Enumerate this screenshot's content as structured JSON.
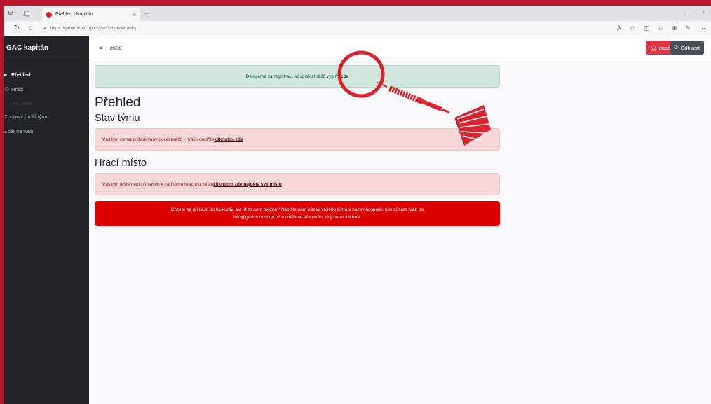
{
  "browser": {
    "tab_title": "Přehled | Kapitán",
    "tab_close": "×",
    "new_tab": "+",
    "url": "https://gambrinuscup.cz/tym?show=thanks",
    "minimize": "–",
    "restore": "▫"
  },
  "sidebar": {
    "brand": "GAC kapitán",
    "items": [
      {
        "label": "Přehled",
        "icon": "dashboard-icon"
      },
      {
        "label": "Hráči",
        "icon": "players-icon"
      }
    ],
    "heading": "ZÁKLADNÍ",
    "links": [
      {
        "label": "Zobrazit profil týmu"
      },
      {
        "label": "Zpět na web"
      }
    ]
  },
  "topbar": {
    "user_text": "csad",
    "user_button": "dasd",
    "logout_button": "Odhlásit"
  },
  "alerts": {
    "success_text": "Děkujeme za registraci, soupisku hráčů vyplňte ",
    "success_link": "zde",
    "team_text": "Váš tým nemá požadovaný počet hráčů - hráče doplňte ",
    "team_link": "kliknutím zde",
    "place_text": "Váš tým ještě není přihlášen k žádnému hracímu místu ",
    "place_link": "kliknutím zde najděte své místo",
    "pub_line1": "Chcete se přihlásit do hospody, ale již to není možné? Napište nám název vašeho týmu a název hospody, kde chcete hrát, na",
    "pub_line2": "info@gambrinuscup.cz a uděláme vše proto, abyste mohli hrát."
  },
  "headings": {
    "overview": "Přehled",
    "team_status": "Stav týmu",
    "play_place": "Hrací místo"
  },
  "colors": {
    "background": "#b8162a",
    "annotation": "#d9232e",
    "sidebar": "#212529",
    "danger": "#dc0000"
  }
}
